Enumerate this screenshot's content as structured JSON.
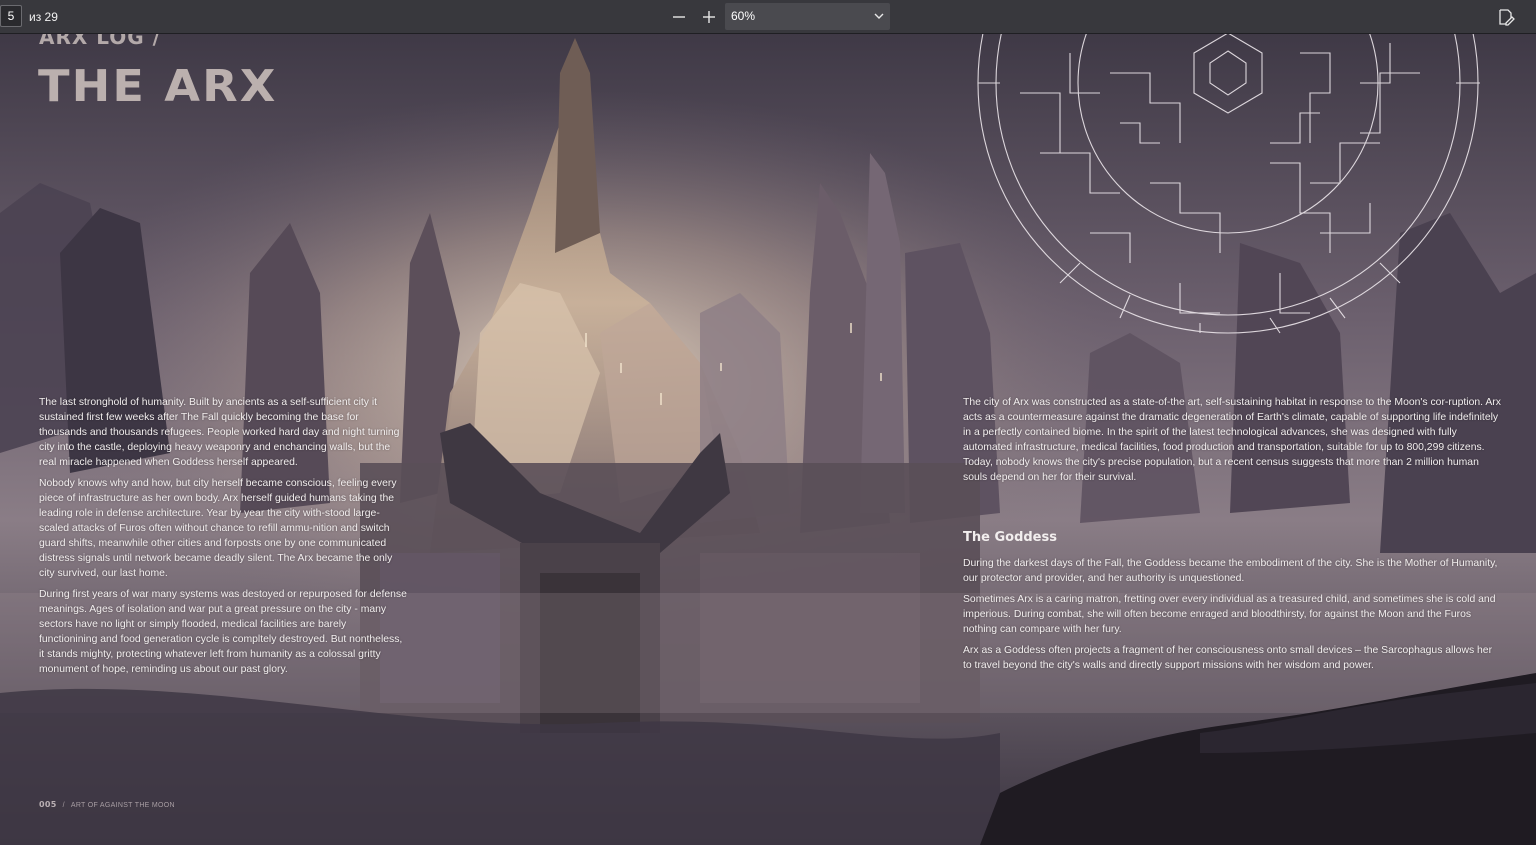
{
  "toolbar": {
    "page_number": "5",
    "page_total": "из 29",
    "zoom_value": "60%"
  },
  "page": {
    "log_label": "ARX LOG /",
    "title": "THE ARX",
    "left_paragraphs": [
      "The last stronghold of humanity. Built by ancients as a self-sufficient city it sustained first few weeks after The Fall quickly becoming the base for thousands and thousands refugees. People worked hard day and night turning city into the castle, deploying heavy weaponry and enchancing walls, but the real miracle happened when Goddess herself appeared.",
      "Nobody knows why and how, but city herself became conscious, feeling every piece of infrastructure as her own body. Arx herself guided humans taking the leading role in defense architecture. Year by year the city with-stood large-scaled attacks of Furos often without chance to refill ammu-nition and switch guard shifts, meanwhile other cities and forposts one by one communicated distress signals until network became deadly silent. The Arx became the only city survived, our last home.",
      "During first years of war many systems was destoyed or repurposed for defense meanings. Ages of isolation and war put a great pressure on the city - many sectors have no light or simply flooded, medical facilities are barely functionining and food generation cycle is compltely destroyed. But nontheless, it stands mighty, protecting whatever left from humanity as a colossal gritty monument of hope, reminding us about our past glory."
    ],
    "right_top_paragraph": "The city of Arx was constructed as a state-of-the art, self-sustaining habitat in response to the Moon's cor-ruption. Arx acts as a countermeasure against the dramatic degeneration of Earth's climate, capable of supporting life indefinitely in a perfectly contained biome. In the spirit of the latest technological advances, she was designed with fully automated infrastructure, medical facilities, food production and transportation, suitable for up to 800,299 citizens. Today, nobody knows the city's precise population, but a recent census suggests that more than 2 million human souls depend on her for their survival.",
    "goddess_heading": "The Goddess",
    "goddess_paragraphs": [
      "During the darkest days of the Fall, the Goddess became the embodiment of the city. She is the Mother of Humanity, our protector and provider, and her authority is unquestioned.",
      "Sometimes Arx is a caring matron, fretting over every individual as a treasured child, and sometimes she is cold and imperious. During combat, she will often become enraged and bloodthirsty, for against the Moon and the Furos nothing can compare with her fury.",
      "Arx as a Goddess often projects a fragment of her consciousness onto small devices – the Sarcophagus allows her to travel beyond the city's walls and directly support missions with her wisdom and power."
    ],
    "footer_page": "005",
    "footer_sep": "/",
    "footer_book": "ART OF AGAINST THE MOON"
  },
  "colors": {
    "toolbar_bg": "#38383d",
    "sky_top": "#4a4350",
    "sky_mid": "#7a6e7a",
    "haze": "#b8a9a4",
    "glow": "#e8d6c0",
    "rock": "#2b2630"
  },
  "icons": {
    "zoom_out": "minus-icon",
    "zoom_in": "plus-icon",
    "zoom_dropdown": "chevron-down-icon",
    "annotate": "edit-document-icon"
  }
}
